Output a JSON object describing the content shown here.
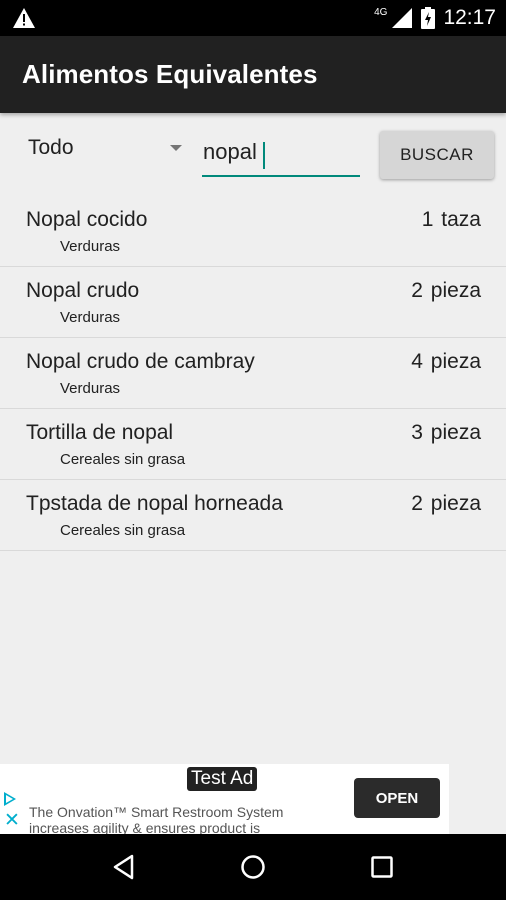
{
  "status_bar": {
    "time": "12:17",
    "network_label": "4G",
    "icons": [
      "warning-icon",
      "signal-icon",
      "battery-icon"
    ]
  },
  "app_bar": {
    "title": "Alimentos Equivalentes"
  },
  "search": {
    "category_selected": "Todo",
    "query": "nopal",
    "button_label": "BUSCAR"
  },
  "results": [
    {
      "name": "Nopal cocido",
      "quantity": "1 taza",
      "category": "Verduras"
    },
    {
      "name": "Nopal crudo",
      "quantity": "2 pieza",
      "category": "Verduras"
    },
    {
      "name": "Nopal crudo de cambray",
      "quantity": "4 pieza",
      "category": "Verduras"
    },
    {
      "name": "Tortilla de nopal",
      "quantity": "3 pieza",
      "category": "Cereales sin grasa"
    },
    {
      "name": "Tpstada de nopal horneada",
      "quantity": "2 pieza",
      "category": "Cereales sin grasa"
    }
  ],
  "ad": {
    "label": "Test Ad",
    "text_line1": "The Onvation™ Smart Restroom System",
    "text_line2": "increases agility & ensures product is",
    "open_label": "OPEN",
    "accent_color": "#00aecd"
  },
  "nav": {
    "icons": [
      "back-icon",
      "home-icon",
      "recents-icon"
    ]
  },
  "colors": {
    "app_bar": "#212121",
    "accent": "#00897b",
    "background": "#efefef"
  }
}
